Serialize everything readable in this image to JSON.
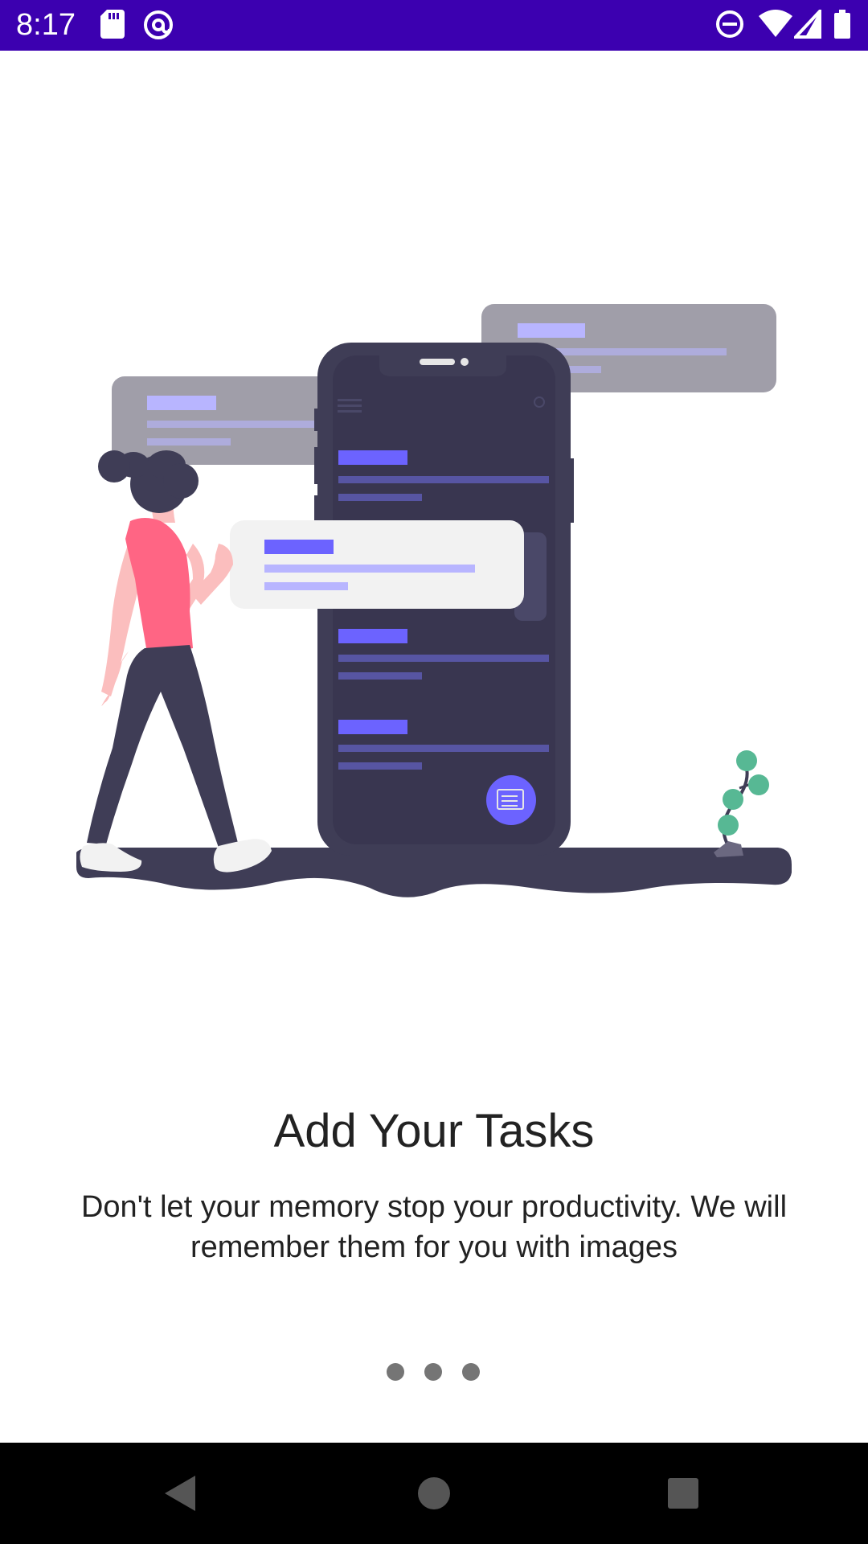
{
  "status_bar": {
    "time": "8:17",
    "left_icons": [
      "sd-card-icon",
      "at-sign-icon"
    ],
    "right_icons": [
      "do-not-disturb-icon",
      "wifi-icon",
      "signal-icon",
      "battery-icon"
    ],
    "background_color": "#3c00b0"
  },
  "onboarding": {
    "title": "Add Your Tasks",
    "description": "Don't let your memory stop your productivity. We will remember them for you with images",
    "page_indicator": {
      "total_pages": 3,
      "dot_color": "#757575"
    },
    "illustration_accent_color": "#6c63ff"
  },
  "navigation_bar": {
    "buttons": [
      "back-icon",
      "home-icon",
      "recents-icon"
    ]
  }
}
